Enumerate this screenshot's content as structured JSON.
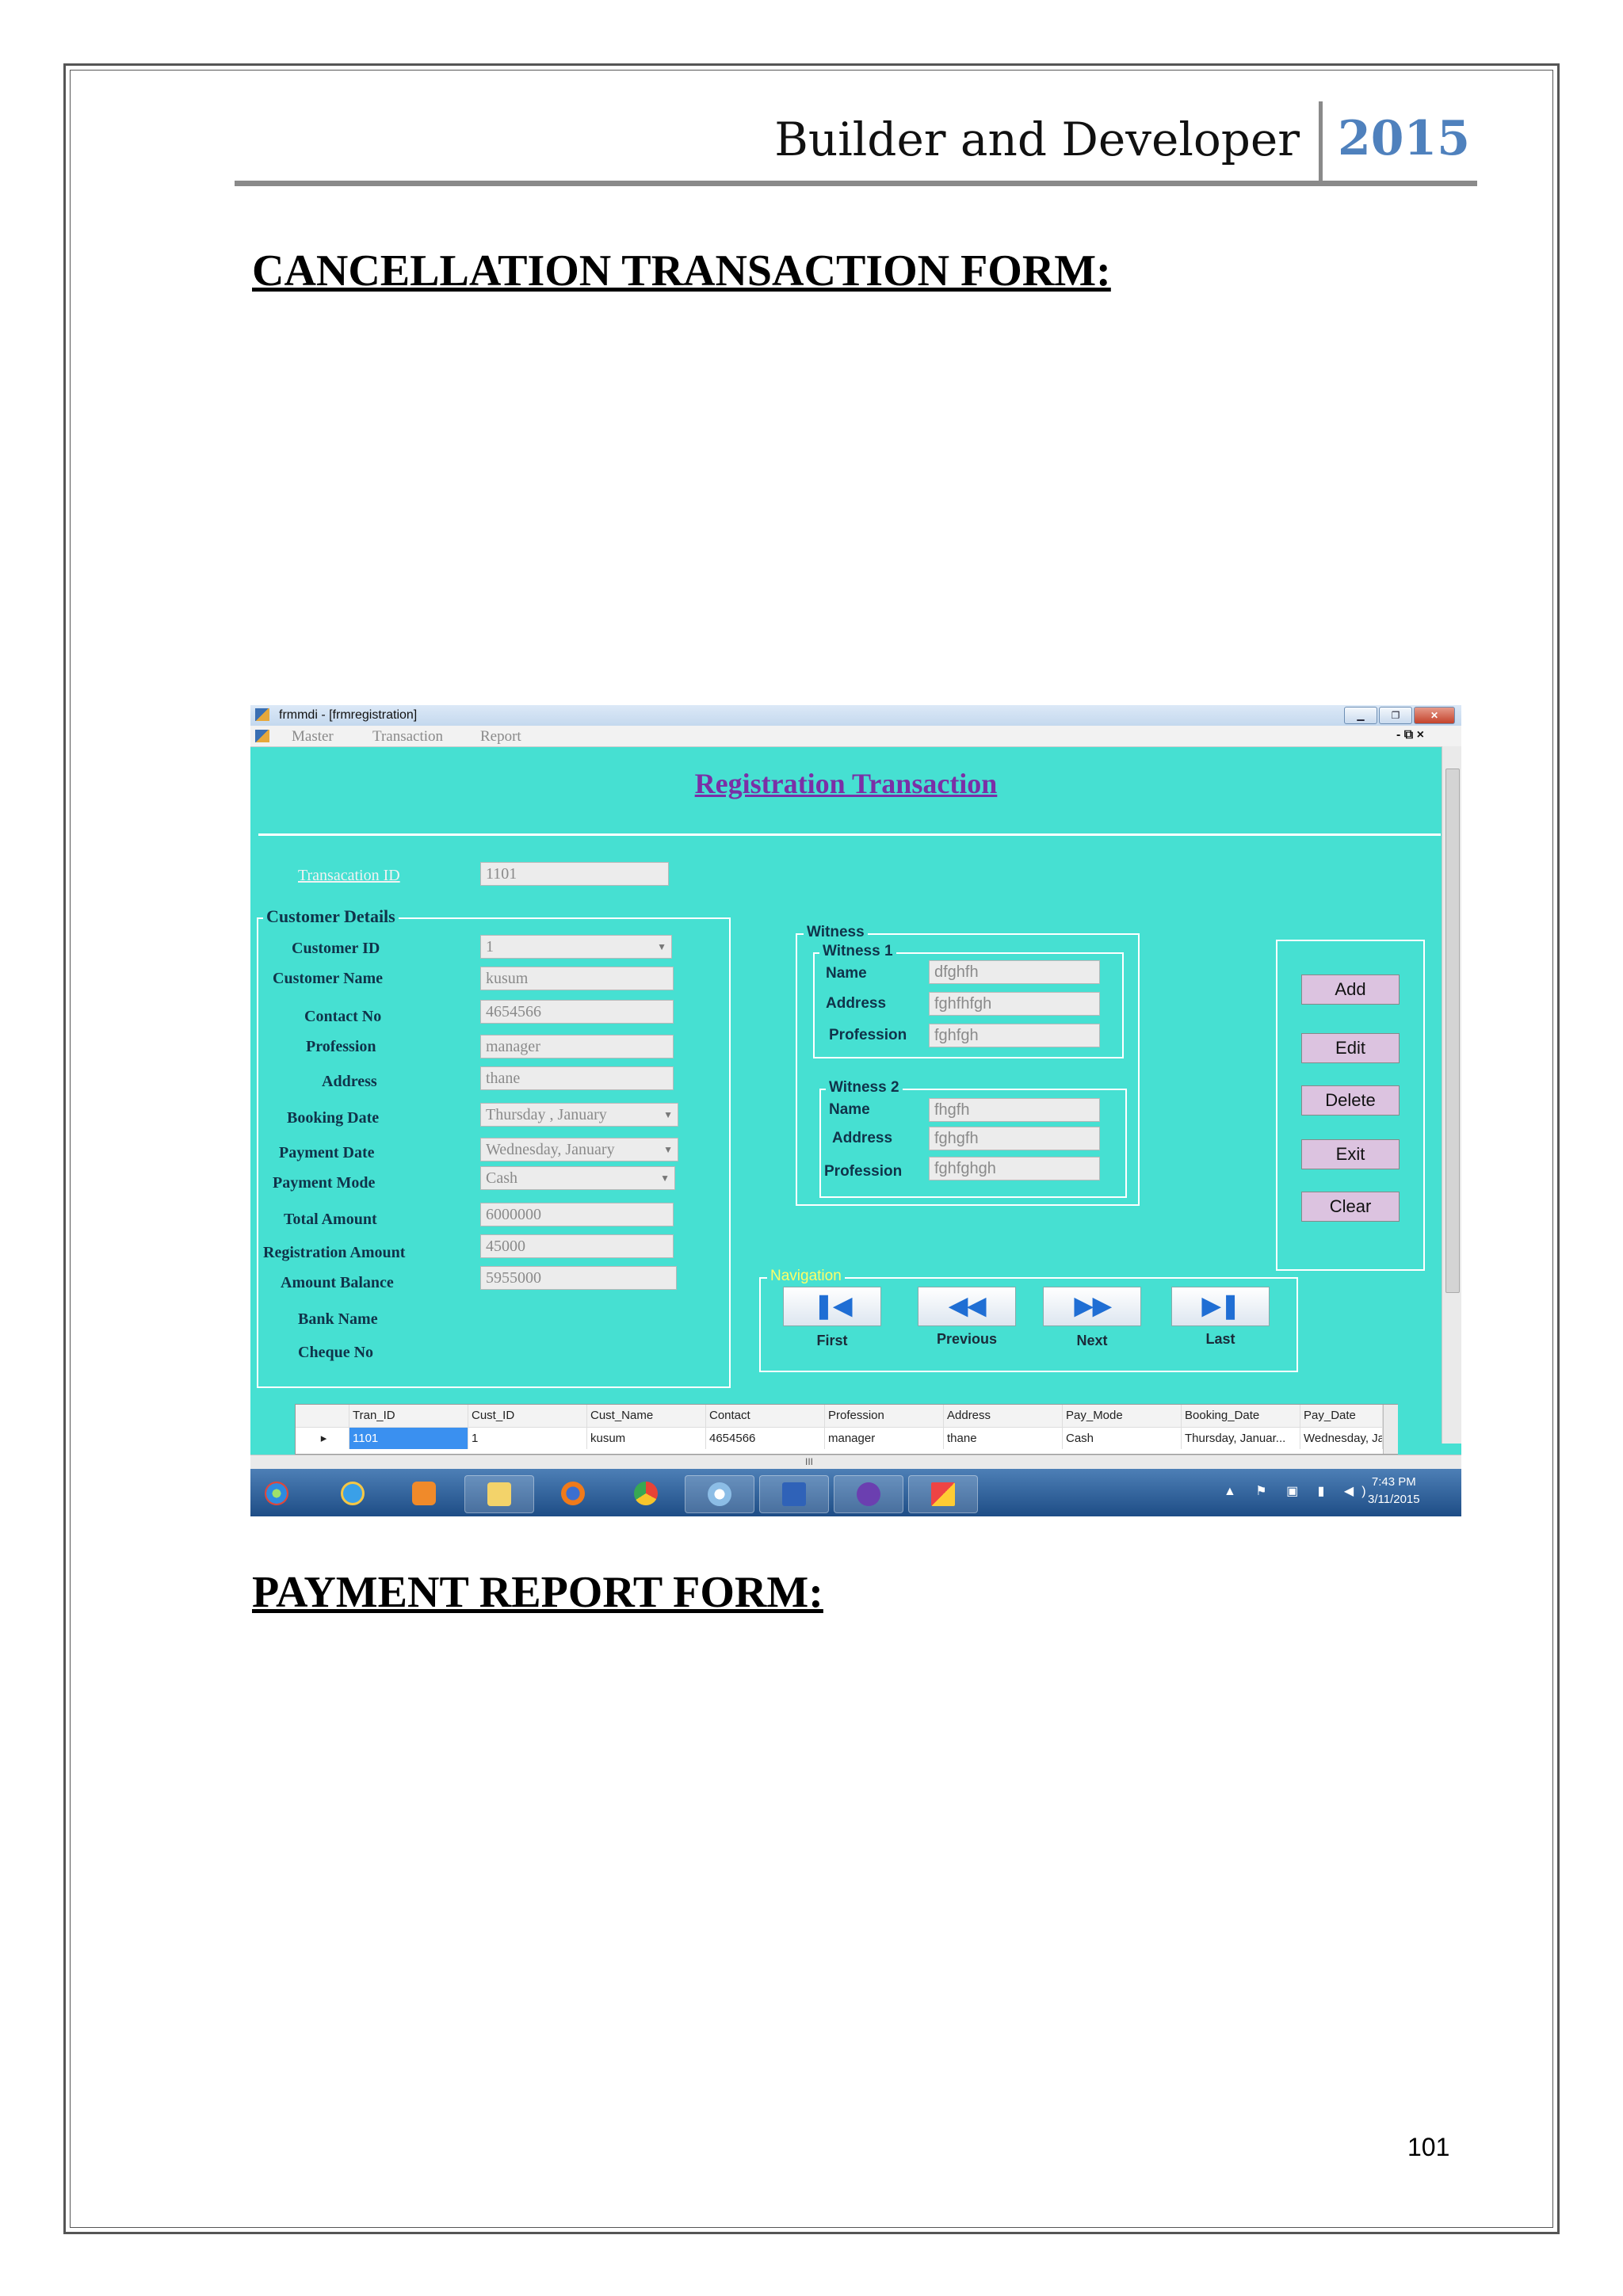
{
  "header": {
    "title": "Builder and Developer",
    "year": "2015"
  },
  "sections": {
    "first": "CANCELLATION TRANSACTION FORM: ",
    "second": "PAYMENT REPORT FORM:"
  },
  "page_number": "101",
  "window": {
    "title": "frmmdi - [frmregistration]",
    "menu": [
      "Master",
      "Transaction",
      "Report"
    ],
    "mdi_controls": "- ⧉ ×"
  },
  "form": {
    "title": "Registration Transaction",
    "transaction_id_label": "Transacation ID",
    "transaction_id": "1101",
    "customer_group": "Customer Details",
    "fields": [
      {
        "label": "Customer ID",
        "value": "1"
      },
      {
        "label": "Customer Name",
        "value": "kusum"
      },
      {
        "label": "Contact No",
        "value": "4654566"
      },
      {
        "label": "Profession",
        "value": "manager"
      },
      {
        "label": "Address",
        "value": "thane"
      },
      {
        "label": "Booking Date",
        "value": "Thursday ,   January"
      },
      {
        "label": "Payment Date",
        "value": "Wednesday,   January"
      },
      {
        "label": "Payment Mode",
        "value": "Cash"
      },
      {
        "label": "Total Amount",
        "value": "6000000"
      },
      {
        "label": "Registration Amount",
        "value": "45000"
      },
      {
        "label": "Amount Balance",
        "value": "5955000"
      },
      {
        "label": "Bank Name",
        "value": ""
      },
      {
        "label": "Cheque No",
        "value": ""
      }
    ],
    "witness": {
      "group": "Witness",
      "w1": {
        "title": "Witness 1",
        "name_label": "Name",
        "name": "dfghfh",
        "address_label": "Address",
        "address": "fghfhfgh",
        "profession_label": "Profession",
        "profession": "fghfgh"
      },
      "w2": {
        "title": "Witness 2",
        "name_label": "Name",
        "name": "fhgfh",
        "address_label": "Address",
        "address": "fghgfh",
        "profession_label": "Profession",
        "profession": "fghfghgh"
      }
    },
    "buttons": [
      "Add",
      "Edit",
      "Delete",
      "Exit",
      "Clear"
    ],
    "navigation": {
      "group": "Navigation",
      "items": [
        {
          "glyph": "❚◀",
          "label": "First"
        },
        {
          "glyph": "◀◀",
          "label": "Previous"
        },
        {
          "glyph": "▶▶",
          "label": "Next"
        },
        {
          "glyph": "▶❚",
          "label": "Last"
        }
      ]
    },
    "grid": {
      "columns": [
        "Tran_ID",
        "Cust_ID",
        "Cust_Name",
        "Contact",
        "Profession",
        "Address",
        "Pay_Mode",
        "Booking_Date",
        "Pay_Date"
      ],
      "rows": [
        [
          "1101",
          "1",
          "kusum",
          "4654566",
          "manager",
          "thane",
          "Cash",
          "Thursday, Januar...",
          "Wednesday, Ja"
        ]
      ],
      "row_marker": "▸",
      "hscroll_mark": "III"
    }
  },
  "taskbar": {
    "time": "7:43 PM",
    "date": "3/11/2015",
    "icons": [
      "windows-start-icon",
      "internet-explorer-icon",
      "media-player-icon",
      "file-explorer-icon",
      "firefox-icon",
      "chrome-icon",
      "paint-icon",
      "word-icon",
      "visual-studio-icon",
      "app-window-icon"
    ],
    "tray": "▲ ⚑ ▣ ▮ ◀)"
  },
  "colors": {
    "form_bg": "#46e0d2",
    "title_purple": "#7b2fa6",
    "year_blue": "#4f81bd",
    "button_bg": "#dcc3e0"
  }
}
